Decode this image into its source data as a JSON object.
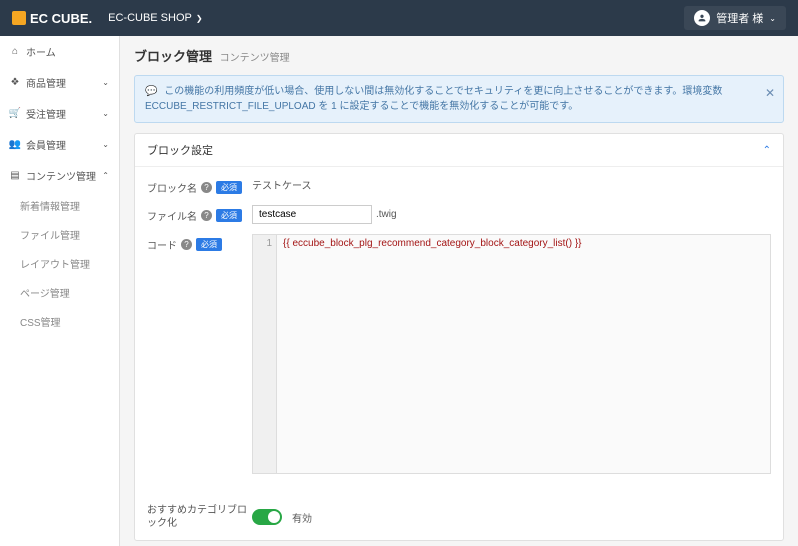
{
  "header": {
    "logo": "EC CUBE.",
    "shop_name": "EC-CUBE SHOP",
    "user_label": "管理者 様"
  },
  "nav": {
    "items": [
      {
        "label": "ホーム"
      },
      {
        "label": "商品管理"
      },
      {
        "label": "受注管理"
      },
      {
        "label": "会員管理"
      },
      {
        "label": "コンテンツ管理"
      }
    ],
    "sub_items": [
      {
        "label": "新着情報管理"
      },
      {
        "label": "ファイル管理"
      },
      {
        "label": "レイアウト管理"
      },
      {
        "label": "ページ管理"
      },
      {
        "label": "CSS管理"
      }
    ]
  },
  "page": {
    "title": "ブロック管理",
    "subtitle": "コンテンツ管理"
  },
  "alert": {
    "text": "この機能の利用頻度が低い場合、使用しない間は無効化することでセキュリティを更に向上させることができます。環境変数 ECCUBE_RESTRICT_FILE_UPLOAD を 1 に設定することで機能を無効化することが可能です。"
  },
  "panel": {
    "title": "ブロック設定"
  },
  "form": {
    "block_name_label": "ブロック名",
    "block_name_value": "テストケース",
    "file_name_label": "ファイル名",
    "file_name_value": "testcase",
    "file_ext": ".twig",
    "code_label": "コード",
    "required_badge": "必須",
    "code_line_1": "{{ eccube_block_plg_recommend_category_block_category_list() }}",
    "recommend_label": "おすすめカテゴリブロック化",
    "enabled_label": "有効"
  }
}
